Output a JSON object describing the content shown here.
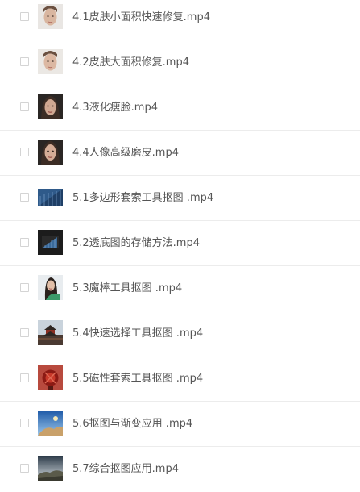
{
  "files": [
    {
      "name": "4.1皮肤小面积快速修复.mp4",
      "icon": "portrait-thumbnail-icon"
    },
    {
      "name": "4.2皮肤大面积修复.mp4",
      "icon": "portrait-thumbnail-icon"
    },
    {
      "name": "4.3液化瘦脸.mp4",
      "icon": "dark-portrait-thumbnail-icon"
    },
    {
      "name": "4.4人像高级磨皮.mp4",
      "icon": "dark-portrait-thumbnail-icon"
    },
    {
      "name": "5.1多边形套索工具抠图 .mp4",
      "icon": "building-thumbnail-icon"
    },
    {
      "name": "5.2透底图的存储方法.mp4",
      "icon": "dark-building-thumbnail-icon"
    },
    {
      "name": "5.3魔棒工具抠图 .mp4",
      "icon": "woman-thumbnail-icon"
    },
    {
      "name": "5.4快速选择工具抠图 .mp4",
      "icon": "pagoda-thumbnail-icon"
    },
    {
      "name": "5.5磁性套索工具抠图 .mp4",
      "icon": "red-object-thumbnail-icon"
    },
    {
      "name": "5.6抠图与渐变应用 .mp4",
      "icon": "sky-thumbnail-icon"
    },
    {
      "name": "5.7综合抠图应用.mp4",
      "icon": "landscape-thumbnail-icon"
    }
  ]
}
